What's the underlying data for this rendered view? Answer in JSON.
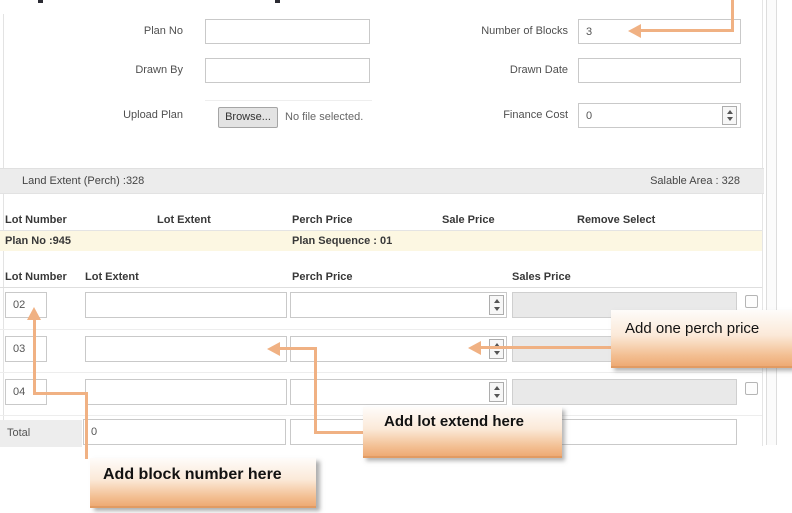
{
  "form": {
    "plan_no": {
      "label": "Plan No",
      "value": ""
    },
    "drawn_by": {
      "label": "Drawn By",
      "value": ""
    },
    "upload_plan": {
      "label": "Upload Plan",
      "browse_label": "Browse...",
      "file_status": "No file selected."
    },
    "number_of_blocks": {
      "label": "Number of Blocks",
      "value": "3"
    },
    "drawn_date": {
      "label": "Drawn Date",
      "value": ""
    },
    "finance_cost": {
      "label": "Finance Cost",
      "value": "0"
    }
  },
  "summary_bar": {
    "land_extent": "Land Extent (Perch) :328",
    "salable_area": "Salable Area : 328"
  },
  "plan_table": {
    "headers": {
      "lot_number": "Lot Number",
      "lot_extent": "Lot Extent",
      "perch_price": "Perch Price",
      "sale_price": "Sale Price",
      "remove_select": "Remove Select"
    },
    "plan_row": {
      "plan_no": "Plan No :945",
      "plan_sequence": "Plan Sequence : 01"
    }
  },
  "lots_table": {
    "headers": {
      "lot_number": "Lot Number",
      "lot_extent": "Lot Extent",
      "perch_price": "Perch Price",
      "sales_price": "Sales Price"
    },
    "rows": [
      {
        "lot_number": "02",
        "lot_extent": "",
        "perch_price": "",
        "sales_price": ""
      },
      {
        "lot_number": "03",
        "lot_extent": "",
        "perch_price": "",
        "sales_price": ""
      },
      {
        "lot_number": "04",
        "lot_extent": "",
        "perch_price": "",
        "sales_price": ""
      }
    ],
    "total": {
      "label": "Total",
      "lot_extent_total": "0",
      "perch_price_total": "",
      "sales_price_total": ""
    }
  },
  "callouts": {
    "perch_price": {
      "text": "Add one perch price"
    },
    "lot_extent": {
      "text": "Add lot extend here"
    },
    "block_number": {
      "text": "Add block number here"
    }
  },
  "colors": {
    "annotation_arrow": "#f0b183",
    "callout_bottom": "#eeaa74",
    "summary_bar_bg": "#ececec",
    "plan_row_bg": "#fcf7e2",
    "disabled_input_bg": "#e9e9e9"
  }
}
